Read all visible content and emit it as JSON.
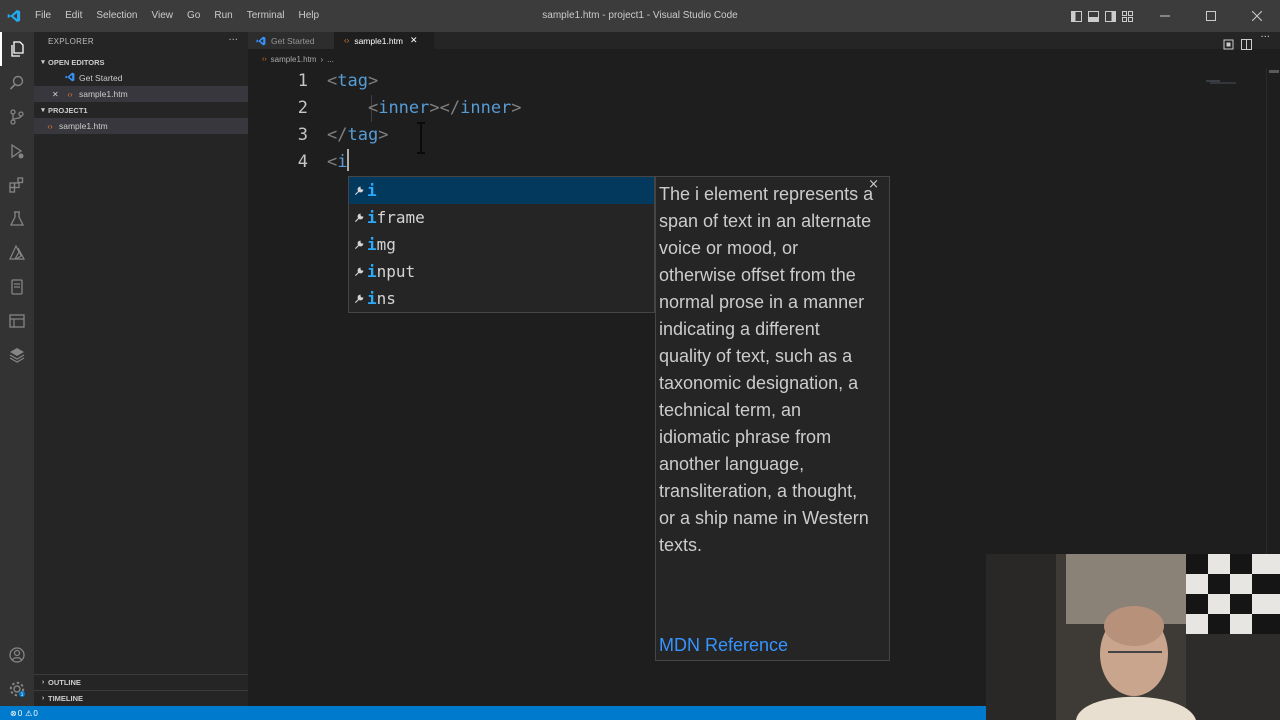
{
  "window": {
    "title": "sample1.htm - project1 - Visual Studio Code"
  },
  "menu": [
    "File",
    "Edit",
    "Selection",
    "View",
    "Go",
    "Run",
    "Terminal",
    "Help"
  ],
  "activity_bar": [
    "files-icon",
    "search-icon",
    "source-control-icon",
    "run-debug-icon",
    "extensions-icon",
    "testing-icon",
    "azure-icon",
    "remote-explorer-icon",
    "docker-icon",
    "accounts-icon",
    "settings-gear-icon"
  ],
  "sidebar": {
    "title": "EXPLORER",
    "more": "···",
    "open_editors": {
      "heading": "OPEN EDITORS",
      "items": [
        {
          "label": "Get Started",
          "icon": "vscode-icon"
        },
        {
          "label": "sample1.htm",
          "icon": "html-file-icon",
          "close": "✕"
        }
      ]
    },
    "project": {
      "heading": "PROJECT1",
      "items": [
        {
          "label": "sample1.htm",
          "icon": "html-file-icon"
        }
      ]
    },
    "outline": "OUTLINE",
    "timeline": "TIMELINE"
  },
  "tabs": [
    {
      "label": "Get Started",
      "active": false
    },
    {
      "label": "sample1.htm",
      "active": true,
      "close": "✕"
    }
  ],
  "breadcrumb": {
    "file": "sample1.htm",
    "sep": "›",
    "more": "..."
  },
  "editor": {
    "lines": [
      {
        "num": "1",
        "parts": [
          {
            "t": "<",
            "c": "punct"
          },
          {
            "t": "tag",
            "c": "tagname"
          },
          {
            "t": ">",
            "c": "punct"
          }
        ]
      },
      {
        "num": "2",
        "parts": [
          {
            "t": "    ",
            "c": "plain"
          },
          {
            "t": "<",
            "c": "punct"
          },
          {
            "t": "inner",
            "c": "tagname"
          },
          {
            "t": "></",
            "c": "punct"
          },
          {
            "t": "inner",
            "c": "tagname"
          },
          {
            "t": ">",
            "c": "punct"
          }
        ]
      },
      {
        "num": "3",
        "parts": [
          {
            "t": "</",
            "c": "punct"
          },
          {
            "t": "tag",
            "c": "tagname"
          },
          {
            "t": ">",
            "c": "punct"
          }
        ]
      },
      {
        "num": "4",
        "parts": [
          {
            "t": "<",
            "c": "punct"
          },
          {
            "t": "i",
            "c": "tagname"
          }
        ]
      }
    ]
  },
  "suggest": {
    "items": [
      {
        "match": "i",
        "rest": "",
        "focused": true
      },
      {
        "match": "i",
        "rest": "frame",
        "focused": false
      },
      {
        "match": "i",
        "rest": "mg",
        "focused": false
      },
      {
        "match": "i",
        "rest": "nput",
        "focused": false
      },
      {
        "match": "i",
        "rest": "ns",
        "focused": false
      }
    ],
    "docs": "The i element represents a span of text in an alternate voice or mood, or otherwise offset from the normal prose in a manner indicating a different quality of text, such as a taxonomic designation, a technical term, an idiomatic phrase from another language, transliteration, a thought, or a ship name in Western texts.",
    "link": "MDN Reference",
    "close": "×"
  },
  "status": {
    "errors": "0",
    "warnings": "0"
  },
  "colors": {
    "accent": "#007acc",
    "suggest_focus": "#04395e",
    "link": "#3794ff"
  }
}
